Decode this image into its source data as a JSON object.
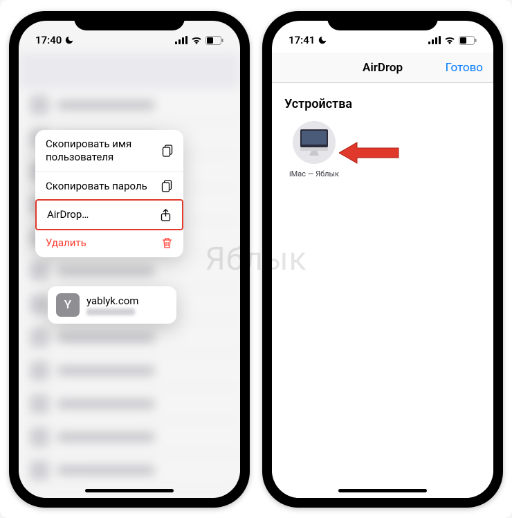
{
  "watermark": "Яблык",
  "phone_left": {
    "status": {
      "time": "17:40"
    },
    "context_menu": {
      "items": [
        {
          "label": "Скопировать имя пользователя",
          "icon": "copy-icon",
          "destructive": false
        },
        {
          "label": "Скопировать пароль",
          "icon": "copy-icon",
          "destructive": false
        },
        {
          "label": "AirDrop…",
          "icon": "share-icon",
          "destructive": false,
          "highlighted": true
        },
        {
          "label": "Удалить",
          "icon": "trash-icon",
          "destructive": true
        }
      ]
    },
    "preview": {
      "avatar_letter": "Y",
      "site": "yablyk.com"
    }
  },
  "phone_right": {
    "status": {
      "time": "17:41"
    },
    "header": {
      "title": "AirDrop",
      "done_label": "Готово"
    },
    "section_title": "Устройства",
    "devices": [
      {
        "name": "iMac — Яблык"
      }
    ]
  }
}
